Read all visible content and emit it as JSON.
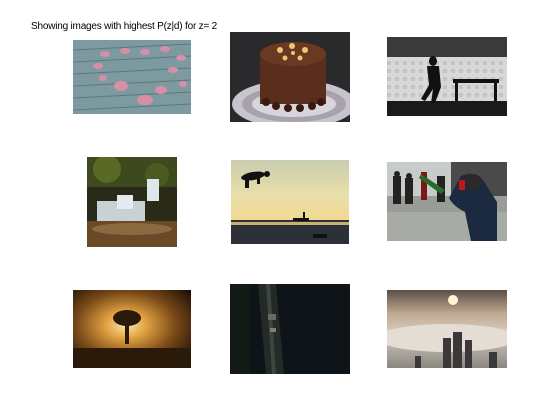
{
  "figure": {
    "caption": "Showing images with highest P(z|d) for z= 2"
  },
  "images": [
    {
      "id": "img-petals",
      "subject": "pink flower petals on wooden boards"
    },
    {
      "id": "img-cake",
      "subject": "chocolate cake with gold decorations on plate"
    },
    {
      "id": "img-silhouette",
      "subject": "black and white silhouette of man walking past bench"
    },
    {
      "id": "img-waterfall",
      "subject": "small waterfall in mossy forest stream"
    },
    {
      "id": "img-skater",
      "subject": "skateboarder silhouette jumping over sea at sunset"
    },
    {
      "id": "img-bottle-player",
      "subject": "people in street with man swinging giant bottle"
    },
    {
      "id": "img-sunset-tree",
      "subject": "tree silhouette against golden sunset"
    },
    {
      "id": "img-dark-aerial",
      "subject": "dark aerial view of road"
    },
    {
      "id": "img-fog-city",
      "subject": "skyscrapers above fog at sunrise"
    }
  ]
}
